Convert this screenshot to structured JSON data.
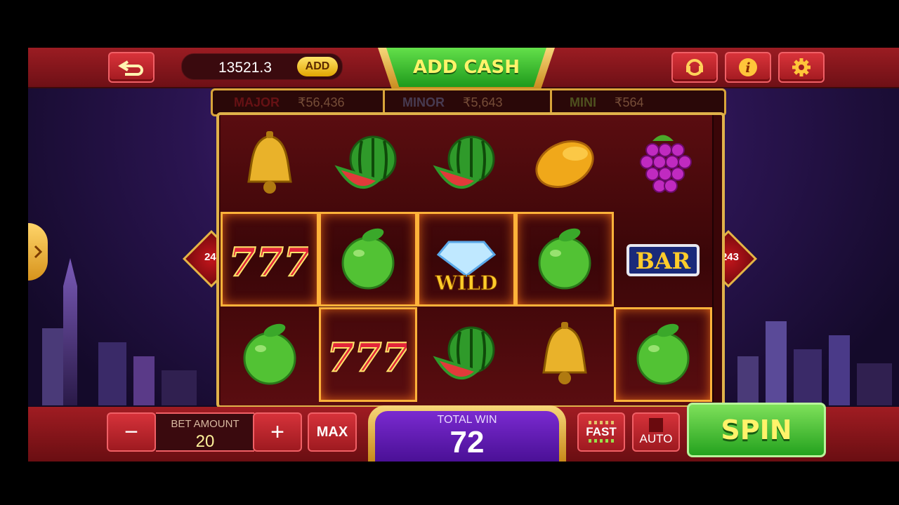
{
  "header": {
    "balance": "13521.3",
    "add_label": "ADD",
    "add_cash_label": "ADD CASH"
  },
  "jackpots": [
    {
      "name": "MAJOR",
      "amount": "₹56,436",
      "color": "#b01e24"
    },
    {
      "name": "MINOR",
      "amount": "₹5,643",
      "color": "#6a78a8"
    },
    {
      "name": "MINI",
      "amount": "₹564",
      "color": "#7aa83a"
    }
  ],
  "ways": "243",
  "reels": [
    [
      "bell",
      "seven",
      "apple"
    ],
    [
      "watermelon",
      "apple",
      "seven"
    ],
    [
      "watermelon",
      "wild",
      "watermelon"
    ],
    [
      "mango",
      "apple",
      "bell"
    ],
    [
      "grapes",
      "bar",
      "apple"
    ]
  ],
  "symbol_text": {
    "seven": "777",
    "wild": "WILD",
    "bar": "BAR"
  },
  "bottom": {
    "minus_label": "−",
    "bet_label": "BET AMOUNT",
    "bet_value": "20",
    "plus_label": "+",
    "max_label": "MAX",
    "total_win_label": "TOTAL WIN",
    "total_win_value": "72",
    "fast_label": "FAST",
    "auto_label": "AUTO",
    "spin_label": "SPIN"
  },
  "icons": {
    "back": "back-arrow-icon",
    "support": "headset-icon",
    "info": "info-icon",
    "settings": "gear-icon",
    "side_tab": "chevron-right-icon"
  }
}
